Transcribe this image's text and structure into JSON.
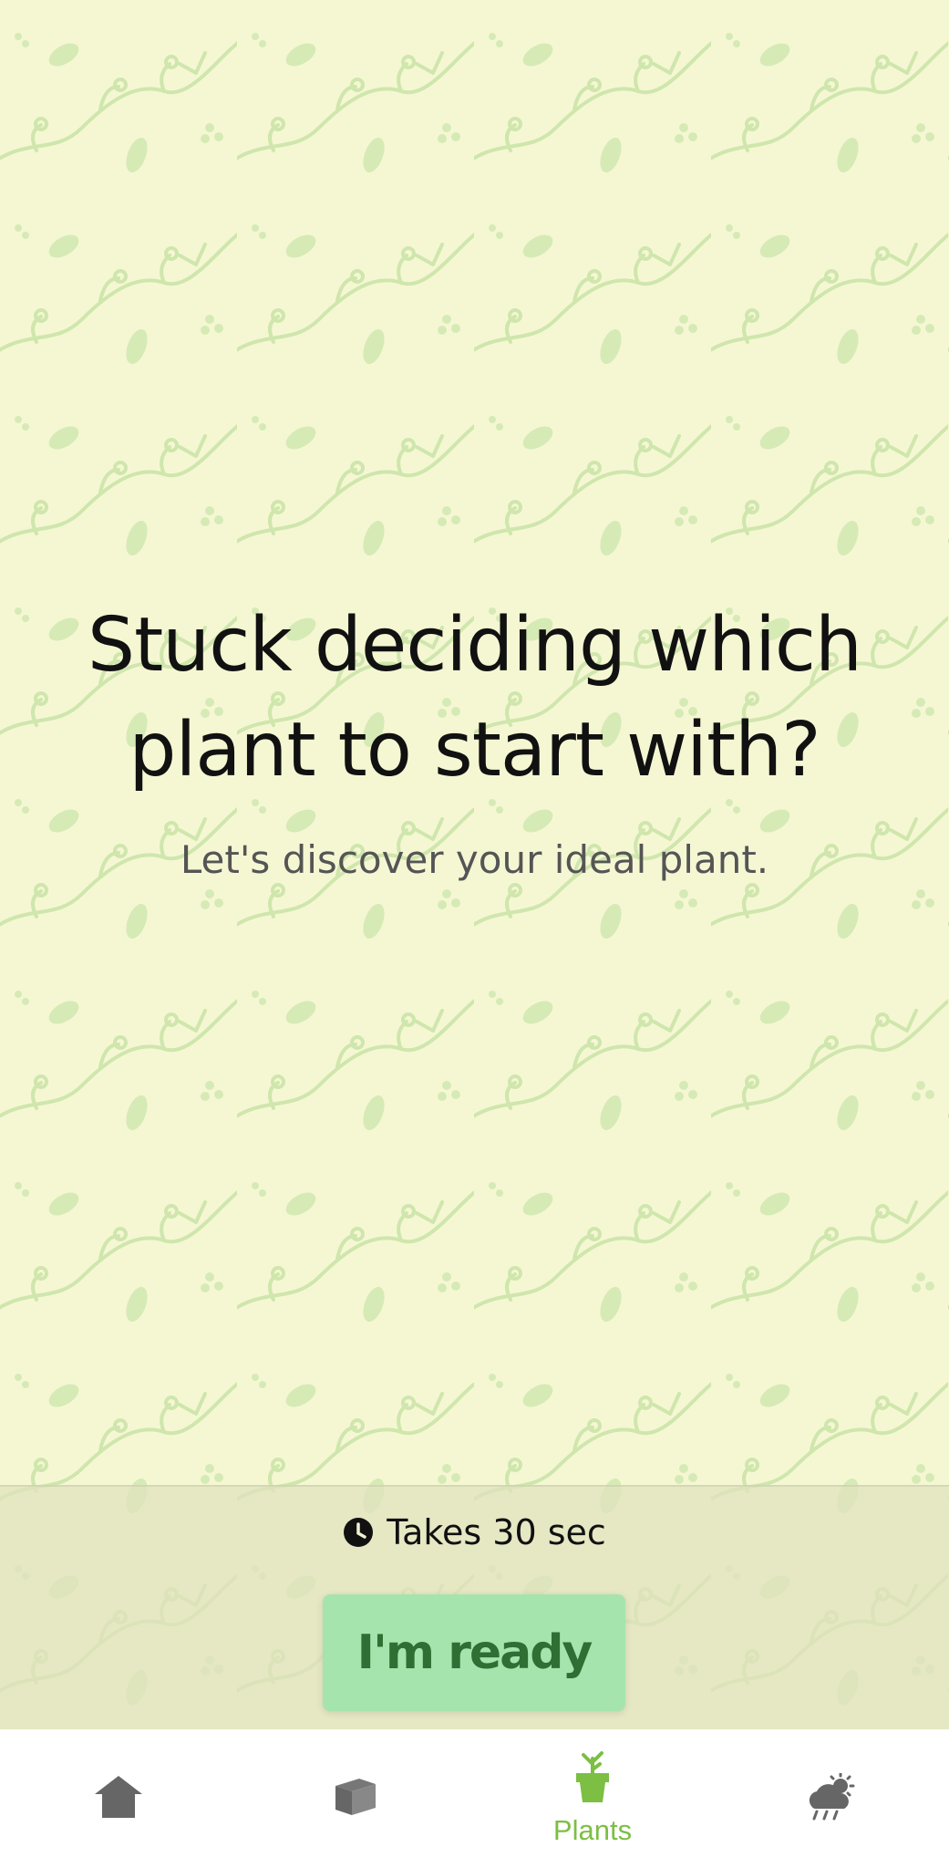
{
  "hero": {
    "title_line1": "Stuck deciding which",
    "title_line2": "plant to start with?",
    "subtitle": "Let's discover your ideal plant."
  },
  "cta": {
    "duration_text": "Takes 30 sec",
    "button_label": "I'm ready"
  },
  "bottom_nav": {
    "items": [
      {
        "icon": "home-icon",
        "label": ""
      },
      {
        "icon": "box-icon",
        "label": ""
      },
      {
        "icon": "potted-plant-icon",
        "label": "Plants",
        "active": true
      },
      {
        "icon": "weather-icon",
        "label": ""
      }
    ]
  },
  "colors": {
    "background": "#f5f7d3",
    "pattern": "#c9e3a6",
    "button": "#a6e4ae",
    "button_text": "#2f6f34",
    "nav_active": "#7cbf43",
    "nav_inactive": "#666666"
  }
}
